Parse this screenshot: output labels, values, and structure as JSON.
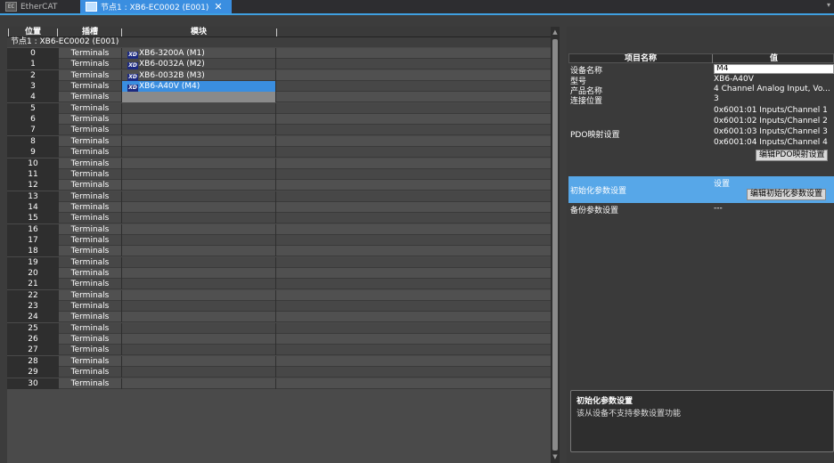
{
  "tabs": [
    {
      "icon_text": "EtherCAT",
      "label": "EtherCAT"
    },
    {
      "label": "节点1 : XB6-EC0002 (E001)"
    }
  ],
  "table": {
    "headers": {
      "position": "位置",
      "slot": "插槽",
      "module": "模块"
    },
    "group": "节点1 : XB6-EC0002 (E001)",
    "rows": [
      {
        "pos": "0",
        "slot": "Terminals",
        "module": "XB6-3200A (M1)",
        "brand": "XD"
      },
      {
        "pos": "1",
        "slot": "Terminals",
        "module": "XB6-0032A (M2)",
        "brand": "XD"
      },
      {
        "pos": "2",
        "slot": "Terminals",
        "module": "XB6-0032B (M3)",
        "brand": "XD"
      },
      {
        "pos": "3",
        "slot": "Terminals",
        "module": "XB6-A40V (M4)",
        "brand": "XD"
      },
      {
        "pos": "4",
        "slot": "Terminals",
        "module": ""
      },
      {
        "pos": "5",
        "slot": "Terminals",
        "module": ""
      },
      {
        "pos": "6",
        "slot": "Terminals",
        "module": ""
      },
      {
        "pos": "7",
        "slot": "Terminals",
        "module": ""
      },
      {
        "pos": "8",
        "slot": "Terminals",
        "module": ""
      },
      {
        "pos": "9",
        "slot": "Terminals",
        "module": ""
      },
      {
        "pos": "10",
        "slot": "Terminals",
        "module": ""
      },
      {
        "pos": "11",
        "slot": "Terminals",
        "module": ""
      },
      {
        "pos": "12",
        "slot": "Terminals",
        "module": ""
      },
      {
        "pos": "13",
        "slot": "Terminals",
        "module": ""
      },
      {
        "pos": "14",
        "slot": "Terminals",
        "module": ""
      },
      {
        "pos": "15",
        "slot": "Terminals",
        "module": ""
      },
      {
        "pos": "16",
        "slot": "Terminals",
        "module": ""
      },
      {
        "pos": "17",
        "slot": "Terminals",
        "module": ""
      },
      {
        "pos": "18",
        "slot": "Terminals",
        "module": ""
      },
      {
        "pos": "19",
        "slot": "Terminals",
        "module": ""
      },
      {
        "pos": "20",
        "slot": "Terminals",
        "module": ""
      },
      {
        "pos": "21",
        "slot": "Terminals",
        "module": ""
      },
      {
        "pos": "22",
        "slot": "Terminals",
        "module": ""
      },
      {
        "pos": "23",
        "slot": "Terminals",
        "module": ""
      },
      {
        "pos": "24",
        "slot": "Terminals",
        "module": ""
      },
      {
        "pos": "25",
        "slot": "Terminals",
        "module": ""
      },
      {
        "pos": "26",
        "slot": "Terminals",
        "module": ""
      },
      {
        "pos": "27",
        "slot": "Terminals",
        "module": ""
      },
      {
        "pos": "28",
        "slot": "Terminals",
        "module": ""
      },
      {
        "pos": "29",
        "slot": "Terminals",
        "module": ""
      },
      {
        "pos": "30",
        "slot": "Terminals",
        "module": ""
      }
    ]
  },
  "props": {
    "header_name": "项目名称",
    "header_value": "值",
    "device_name_label": "设备名称",
    "device_name_value": "M4",
    "model_label": "型号",
    "model_value": "XB6-A40V",
    "product_label": "产品名称",
    "product_value": "4 Channel Analog Input, Vo...",
    "conn_label": "连接位置",
    "conn_value": "3",
    "pdo_label": "PDO映射设置",
    "pdo_values": [
      "0x6001:01 Inputs/Channel 1",
      "0x6001:02 Inputs/Channel 2",
      "0x6001:03 Inputs/Channel 3",
      "0x6001:04 Inputs/Channel 4"
    ],
    "pdo_edit_button": "编辑PDO映射设置",
    "init_label": "初始化参数设置",
    "init_value": "设置",
    "init_edit_button": "编辑初始化参数设置",
    "backup_label": "备份参数设置",
    "backup_value": "---"
  },
  "info": {
    "title": "初始化参数设置",
    "desc": "该从设备不支持参数设置功能"
  },
  "colors": {
    "accent": "#3a8ee0",
    "highlight": "#57a7e8"
  }
}
